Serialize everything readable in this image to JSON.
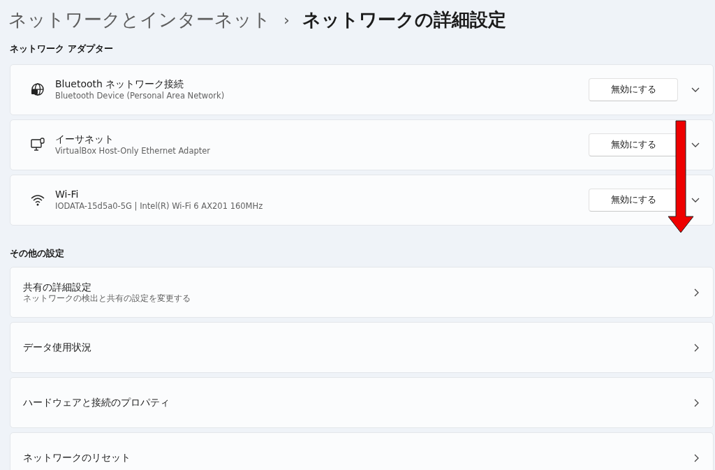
{
  "breadcrumb": {
    "parent": "ネットワークとインターネット",
    "separator": "›",
    "current": "ネットワークの詳細設定"
  },
  "adapters": {
    "heading": "ネットワーク アダプター",
    "items": [
      {
        "kind": "bluetooth",
        "name": "Bluetooth ネットワーク接続",
        "description": "Bluetooth Device (Personal Area Network)",
        "button": "無効にする",
        "expanded": false
      },
      {
        "kind": "ethernet",
        "name": "イーサネット",
        "description": "VirtualBox Host-Only Ethernet Adapter",
        "button": "無効にする",
        "expanded": false
      },
      {
        "kind": "wifi",
        "name": "Wi-Fi",
        "description": "IODATA-15d5a0-5G | Intel(R) Wi-Fi 6 AX201 160MHz",
        "button": "無効にする",
        "expanded": false
      }
    ]
  },
  "more_settings": {
    "heading": "その他の設定",
    "items": [
      {
        "title": "共有の詳細設定",
        "description": "ネットワークの検出と共有の設定を変更する"
      },
      {
        "title": "データ使用状況"
      },
      {
        "title": "ハードウェアと接続のプロパティ"
      },
      {
        "title": "ネットワークのリセット"
      }
    ]
  }
}
